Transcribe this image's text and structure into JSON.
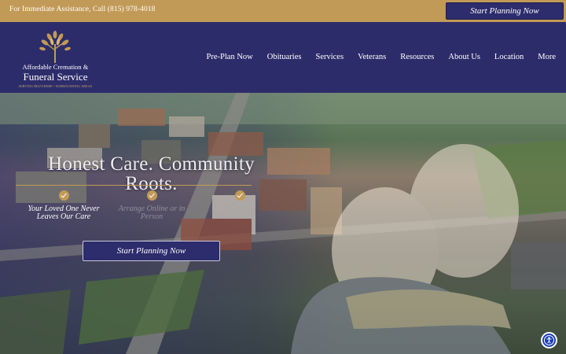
{
  "topbar": {
    "phone_text": "For Immediate Assistance, Call (815) 978-4018",
    "cta_label": "Start Planning Now"
  },
  "logo": {
    "line1": "Affordable Cremation &",
    "line2": "Funeral Service",
    "tagline": "SERVING BELVIDERE • SURROUNDING AREAS"
  },
  "nav": {
    "items": [
      "Pre-Plan Now",
      "Obituaries",
      "Services",
      "Veterans",
      "Resources",
      "About Us",
      "Location",
      "More"
    ]
  },
  "hero": {
    "headline_line1": "Honest Care. Community",
    "headline_line2": "Roots.",
    "features": [
      {
        "line1": "Your Loved One Never",
        "line2": "Leaves Our Care"
      },
      {
        "line1": "Arrange Online or in",
        "line2": "Person"
      },
      {
        "line1": "",
        "line2": ""
      }
    ],
    "cta_label": "Start Planning Now"
  },
  "colors": {
    "navy": "#2d2c6b",
    "gold": "#c29a57",
    "accessibility_blue": "#1c3fb5"
  },
  "icons": {
    "logo": "tree-logo-icon",
    "features": "check-circle-icon",
    "accessibility": "accessibility-icon"
  }
}
